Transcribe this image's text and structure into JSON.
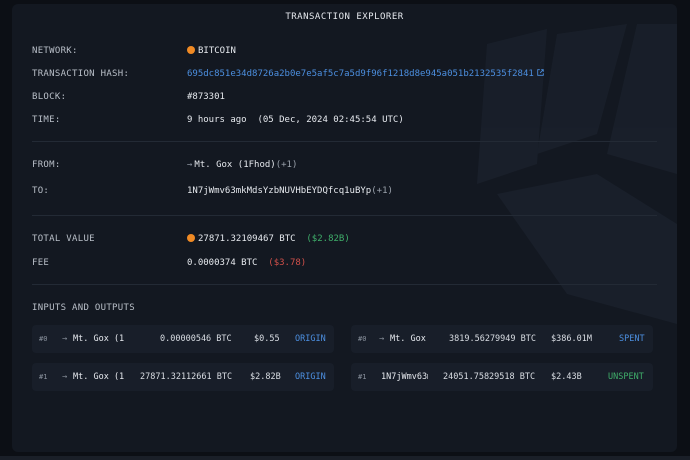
{
  "header": {
    "title": "TRANSACTION EXPLORER"
  },
  "details": {
    "network": {
      "label": "NETWORK:",
      "value": "BITCOIN",
      "icon": "bitcoin-icon"
    },
    "hash": {
      "label": "TRANSACTION HASH:",
      "value": "695dc851e34d8726a2b0e7e5af5c7a5d9f96f1218d8e945a051b2132535f2841"
    },
    "block": {
      "label": "BLOCK:",
      "value": "#873301"
    },
    "time": {
      "label": "TIME:",
      "value": "9 hours ago  (05 Dec, 2024 02:45:54 UTC)"
    },
    "from": {
      "label": "FROM:",
      "name": "Mt. Gox (1Fhod)",
      "extra": "(+1)"
    },
    "to": {
      "label": "TO:",
      "address": "1N7jWmv63mkMdsYzbNUVHbEYDQfcq1uBYp",
      "extra": "(+1)"
    },
    "total_value": {
      "label": "TOTAL VALUE",
      "btc": "27871.32109467 BTC",
      "usd": "($2.82B)"
    },
    "fee": {
      "label": "FEE",
      "btc": "0.0000374 BTC",
      "usd": "($3.78)"
    }
  },
  "io": {
    "title": "INPUTS AND OUTPUTS",
    "inputs": [
      {
        "idx": "#0",
        "name": "Mt. Gox (1Fhod)",
        "amount": "0.00000546 BTC",
        "usd": "$0.55",
        "status": "ORIGIN"
      },
      {
        "idx": "#1",
        "name": "Mt. Gox (1Fhod)",
        "amount": "27871.32112661 BTC",
        "usd": "$2.82B",
        "status": "ORIGIN"
      }
    ],
    "outputs": [
      {
        "idx": "#0",
        "name": "Mt. Gox (1Fhod)",
        "amount": "3819.56279949 BTC",
        "usd": "$386.01M",
        "status": "SPENT"
      },
      {
        "idx": "#1",
        "name": "1N7jWmv63mkMdsYzbNUVHbEYDQfcq1uBYp",
        "amount": "24051.75829518 BTC",
        "usd": "$2.43B",
        "status": "UNSPENT"
      }
    ]
  },
  "colors": {
    "link": "#4c8fe0",
    "positive": "#3fae6a",
    "negative": "#d0504a",
    "bitcoin": "#f08a24"
  }
}
